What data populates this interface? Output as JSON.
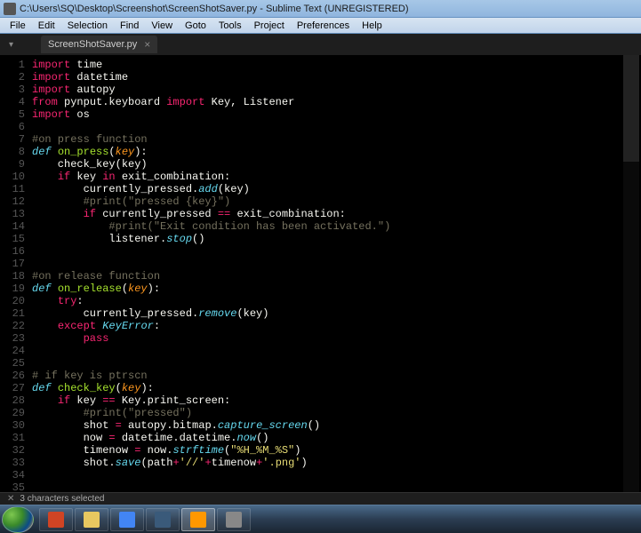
{
  "window": {
    "title": "C:\\Users\\SQ\\Desktop\\Screenshot\\ScreenShotSaver.py - Sublime Text (UNREGISTERED)"
  },
  "menu": {
    "items": [
      "File",
      "Edit",
      "Selection",
      "Find",
      "View",
      "Goto",
      "Tools",
      "Project",
      "Preferences",
      "Help"
    ]
  },
  "tabs": {
    "active": "ScreenShotSaver.py"
  },
  "code": {
    "lines": [
      [
        [
          "k-red",
          "import"
        ],
        [
          "k-white",
          " time"
        ]
      ],
      [
        [
          "k-red",
          "import"
        ],
        [
          "k-white",
          " datetime"
        ]
      ],
      [
        [
          "k-red",
          "import"
        ],
        [
          "k-white",
          " autopy"
        ]
      ],
      [
        [
          "k-red",
          "from"
        ],
        [
          "k-white",
          " pynput.keyboard "
        ],
        [
          "k-red",
          "import"
        ],
        [
          "k-white",
          " Key, Listener"
        ]
      ],
      [
        [
          "k-red",
          "import"
        ],
        [
          "k-white",
          " os"
        ]
      ],
      [],
      [
        [
          "k-grey",
          "#on press function"
        ]
      ],
      [
        [
          "k-blue",
          "def"
        ],
        [
          "k-white",
          " "
        ],
        [
          "k-green",
          "on_press"
        ],
        [
          "k-white",
          "("
        ],
        [
          "k-orange",
          "key"
        ],
        [
          "k-white",
          "):"
        ]
      ],
      [
        [
          "k-white",
          "    check_key(key)"
        ]
      ],
      [
        [
          "k-white",
          "    "
        ],
        [
          "k-red",
          "if"
        ],
        [
          "k-white",
          " key "
        ],
        [
          "k-red",
          "in"
        ],
        [
          "k-white",
          " exit_combination:"
        ]
      ],
      [
        [
          "k-white",
          "        currently_pressed."
        ],
        [
          "k-blue",
          "add"
        ],
        [
          "k-white",
          "(key)"
        ]
      ],
      [
        [
          "k-white",
          "        "
        ],
        [
          "k-grey",
          "#print(\"pressed {key}\")"
        ]
      ],
      [
        [
          "k-white",
          "        "
        ],
        [
          "k-red",
          "if"
        ],
        [
          "k-white",
          " currently_pressed "
        ],
        [
          "k-red",
          "=="
        ],
        [
          "k-white",
          " exit_combination:"
        ]
      ],
      [
        [
          "k-white",
          "            "
        ],
        [
          "k-grey",
          "#print(\"Exit condition has been activated.\")"
        ]
      ],
      [
        [
          "k-white",
          "            listener."
        ],
        [
          "k-blue",
          "stop"
        ],
        [
          "k-white",
          "()"
        ]
      ],
      [],
      [],
      [
        [
          "k-grey",
          "#on release function"
        ]
      ],
      [
        [
          "k-blue",
          "def"
        ],
        [
          "k-white",
          " "
        ],
        [
          "k-green",
          "on_release"
        ],
        [
          "k-white",
          "("
        ],
        [
          "k-orange",
          "key"
        ],
        [
          "k-white",
          "):"
        ]
      ],
      [
        [
          "k-white",
          "    "
        ],
        [
          "k-red",
          "try"
        ],
        [
          "k-white",
          ":"
        ]
      ],
      [
        [
          "k-white",
          "        currently_pressed."
        ],
        [
          "k-blue",
          "remove"
        ],
        [
          "k-white",
          "(key)"
        ]
      ],
      [
        [
          "k-white",
          "    "
        ],
        [
          "k-red",
          "except"
        ],
        [
          "k-white",
          " "
        ],
        [
          "k-blue",
          "KeyError"
        ],
        [
          "k-white",
          ":"
        ]
      ],
      [
        [
          "k-white",
          "        "
        ],
        [
          "k-red",
          "pass"
        ]
      ],
      [],
      [],
      [
        [
          "k-grey",
          "# if key is ptrscn"
        ]
      ],
      [
        [
          "k-blue",
          "def"
        ],
        [
          "k-white",
          " "
        ],
        [
          "k-green",
          "check_key"
        ],
        [
          "k-white",
          "("
        ],
        [
          "k-orange",
          "key"
        ],
        [
          "k-white",
          "):"
        ]
      ],
      [
        [
          "k-white",
          "    "
        ],
        [
          "k-red",
          "if"
        ],
        [
          "k-white",
          " key "
        ],
        [
          "k-red",
          "=="
        ],
        [
          "k-white",
          " Key.print_screen:"
        ]
      ],
      [
        [
          "k-white",
          "        "
        ],
        [
          "k-grey",
          "#print(\"pressed\")"
        ]
      ],
      [
        [
          "k-white",
          "        shot "
        ],
        [
          "k-red",
          "="
        ],
        [
          "k-white",
          " autopy.bitmap."
        ],
        [
          "k-blue",
          "capture_screen"
        ],
        [
          "k-white",
          "()"
        ]
      ],
      [
        [
          "k-white",
          "        now "
        ],
        [
          "k-red",
          "="
        ],
        [
          "k-white",
          " datetime.datetime."
        ],
        [
          "k-blue",
          "now"
        ],
        [
          "k-white",
          "()"
        ]
      ],
      [
        [
          "k-white",
          "        timenow "
        ],
        [
          "k-red",
          "="
        ],
        [
          "k-white",
          " now."
        ],
        [
          "k-blue",
          "strftime"
        ],
        [
          "k-white",
          "("
        ],
        [
          "k-yellow",
          "\"%H_%M_%S\""
        ],
        [
          "k-white",
          ")"
        ]
      ],
      [
        [
          "k-white",
          "        shot."
        ],
        [
          "k-blue",
          "save"
        ],
        [
          "k-white",
          "(path"
        ],
        [
          "k-red",
          "+"
        ],
        [
          "k-yellow",
          "'//'"
        ],
        [
          "k-red",
          "+"
        ],
        [
          "k-white",
          "timenow"
        ],
        [
          "k-red",
          "+"
        ],
        [
          "k-yellow",
          "'.png'"
        ],
        [
          "k-white",
          ")"
        ]
      ],
      [],
      []
    ],
    "line_start": 1
  },
  "status": {
    "text": "3 characters selected"
  },
  "taskbar": {
    "items": [
      {
        "name": "powerpoint",
        "color": "#d04424"
      },
      {
        "name": "explorer",
        "color": "#e8c860"
      },
      {
        "name": "chrome",
        "color": "#4285f4"
      },
      {
        "name": "running",
        "color": "#3a5a7a"
      },
      {
        "name": "sublime",
        "color": "#ff9800",
        "active": true
      },
      {
        "name": "app",
        "color": "#888"
      }
    ]
  }
}
